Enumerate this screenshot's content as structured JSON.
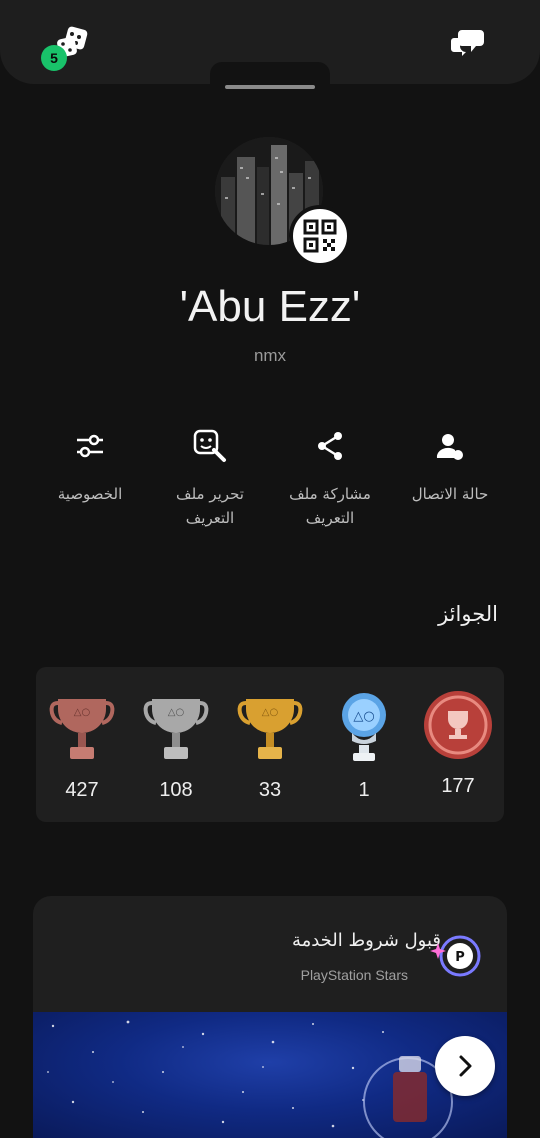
{
  "topbar": {
    "notification_count": "5",
    "dice_icon": "dice-icon",
    "chat_icon": "chat-bubbles-icon"
  },
  "profile": {
    "display_name": "'Abu Ezz'",
    "online_id": "nmx",
    "qr_icon": "qr-code-icon"
  },
  "actions": [
    {
      "label": "حالة الاتصال",
      "icon": "person-status-icon"
    },
    {
      "label": "مشاركة ملف التعريف",
      "icon": "share-icon"
    },
    {
      "label": "تحرير ملف التعريف",
      "icon": "edit-profile-icon"
    },
    {
      "label": "الخصوصية",
      "icon": "sliders-icon"
    }
  ],
  "trophies": {
    "section_title": "الجوائز",
    "level": "177",
    "platinum": "1",
    "gold": "33",
    "silver": "108",
    "bronze": "427"
  },
  "stars": {
    "title": "قبول شروط الخدمة",
    "subtitle": "PlayStation Stars"
  },
  "colors": {
    "background": "#121212",
    "card": "#1f1f1f",
    "badge": "#19c26a",
    "banner": "#102a84"
  }
}
